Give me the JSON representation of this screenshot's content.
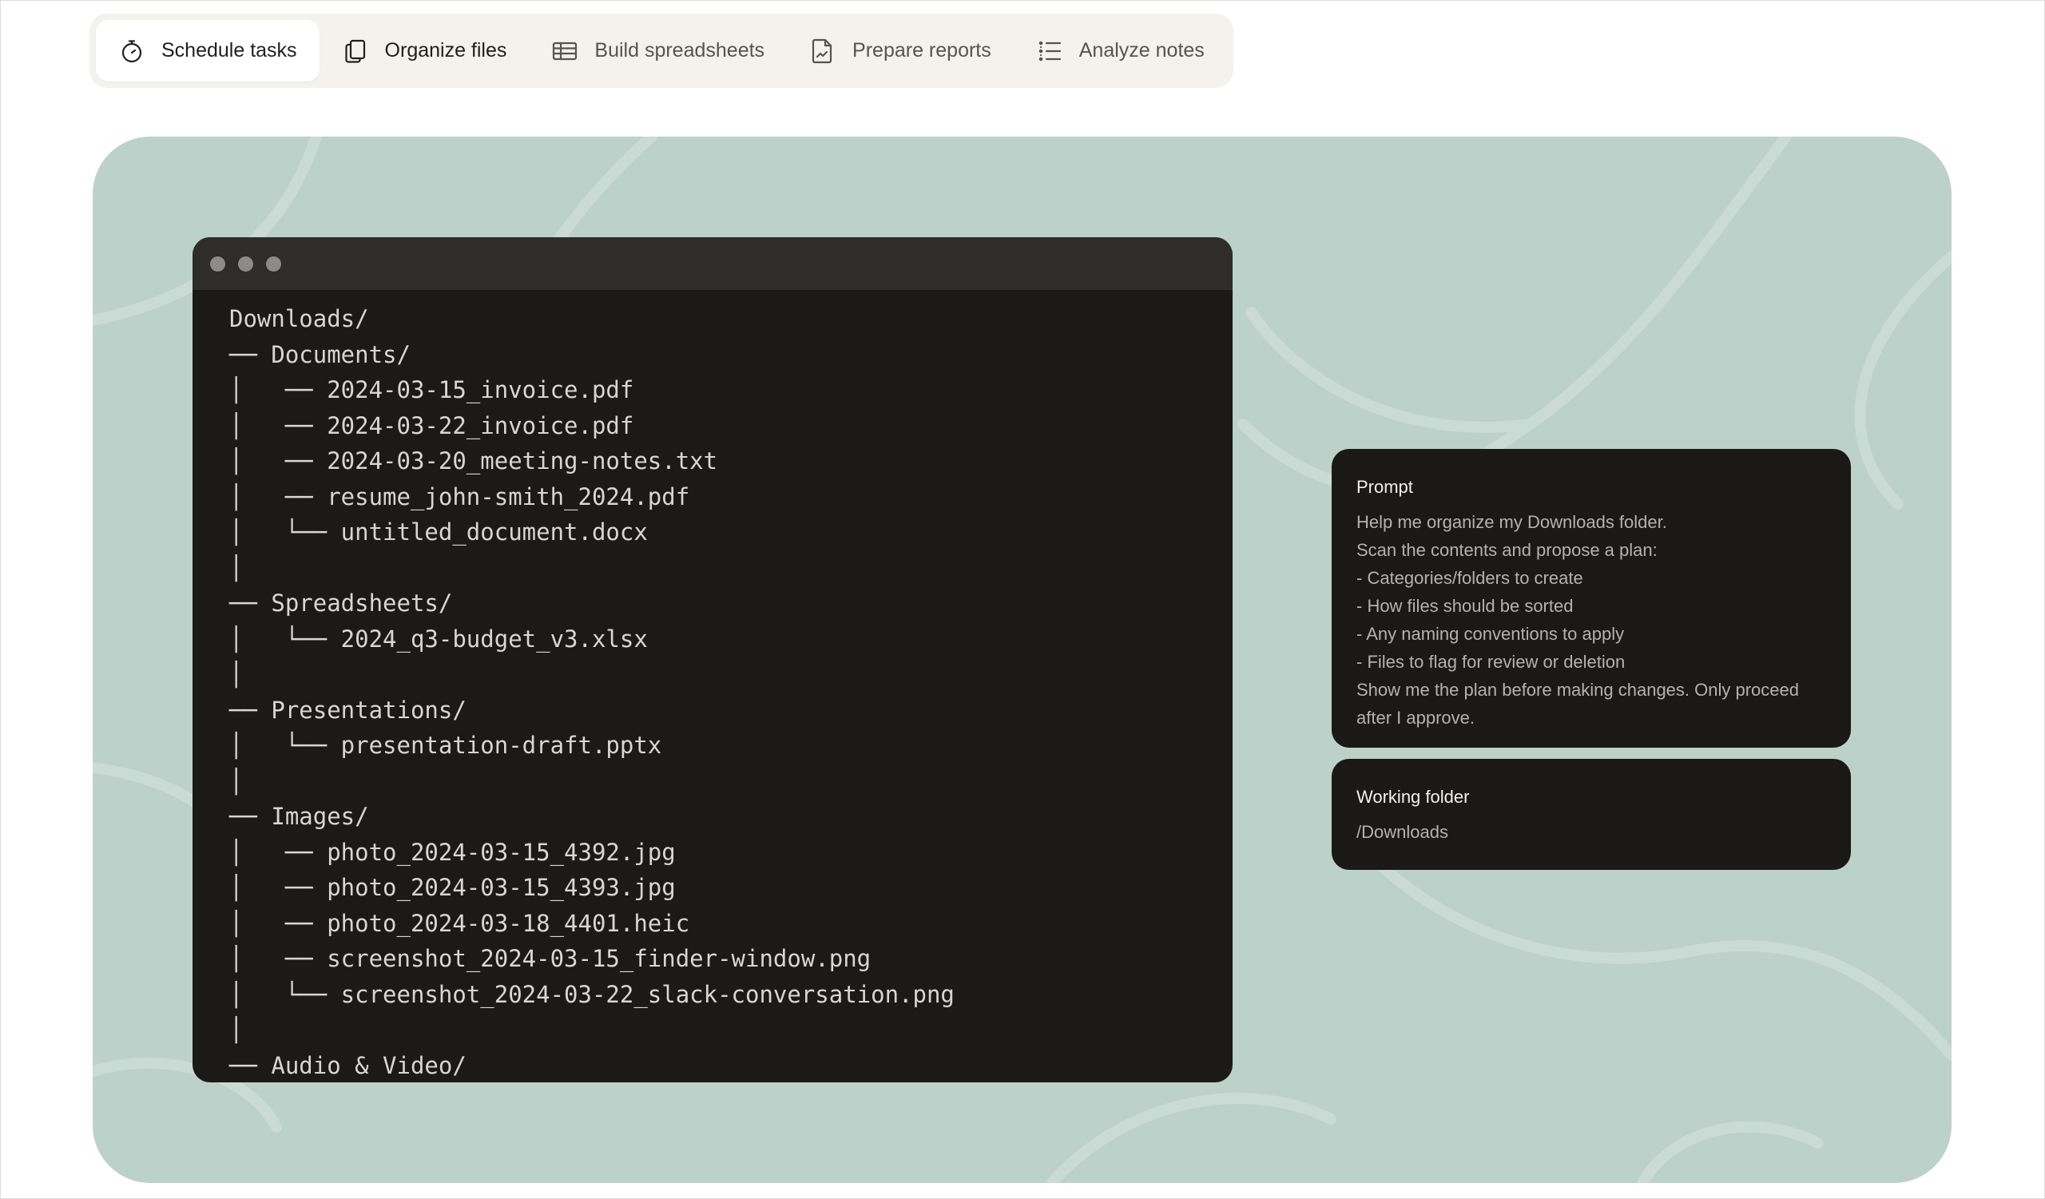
{
  "tabs": [
    {
      "label": "Schedule tasks",
      "icon": "timer-icon",
      "active": true
    },
    {
      "label": "Organize files",
      "icon": "files-icon",
      "active": false
    },
    {
      "label": "Build spreadsheets",
      "icon": "spreadsheet-icon",
      "active": false
    },
    {
      "label": "Prepare reports",
      "icon": "report-icon",
      "active": false
    },
    {
      "label": "Analyze notes",
      "icon": "list-icon",
      "active": false
    }
  ],
  "terminal": {
    "lines": [
      "Downloads/",
      "── Documents/",
      "│   ── 2024-03-15_invoice.pdf",
      "│   ── 2024-03-22_invoice.pdf",
      "│   ── 2024-03-20_meeting-notes.txt",
      "│   ── resume_john-smith_2024.pdf",
      "│   └── untitled_document.docx",
      "│",
      "── Spreadsheets/",
      "│   └── 2024_q3-budget_v3.xlsx",
      "│",
      "── Presentations/",
      "│   └── presentation-draft.pptx",
      "│",
      "── Images/",
      "│   ── photo_2024-03-15_4392.jpg",
      "│   ── photo_2024-03-15_4393.jpg",
      "│   ── photo_2024-03-18_4401.heic",
      "│   ── screenshot_2024-03-15_finder-window.png",
      "│   └── screenshot_2024-03-22_slack-conversation.png",
      "│",
      "── Audio & Video/"
    ]
  },
  "prompt_card": {
    "title": "Prompt",
    "lines": [
      "Help me organize my Downloads folder.",
      "Scan the contents and propose a plan:",
      "- Categories/folders to create",
      "- How files should be sorted",
      "- Any naming conventions to apply",
      "- Files to flag for review or deletion",
      "Show me the plan before making changes. Only proceed",
      "after I approve."
    ]
  },
  "folder_card": {
    "title": "Working folder",
    "value": "/Downloads"
  }
}
